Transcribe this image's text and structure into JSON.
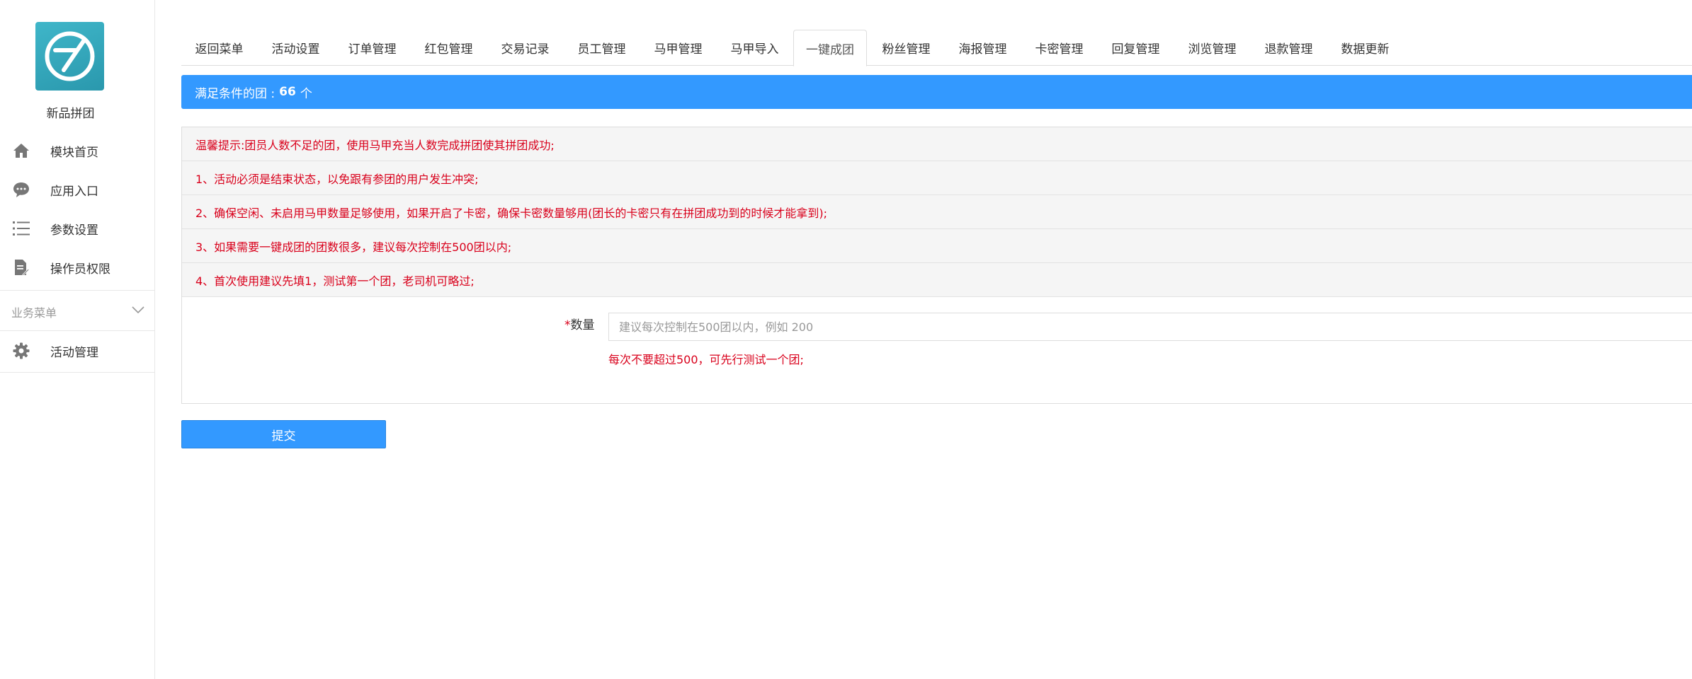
{
  "sidebar": {
    "logo_icon": "app-logo-icon",
    "brand": "新品拼团",
    "items": [
      {
        "label": "模块首页",
        "icon": "home-icon"
      },
      {
        "label": "应用入口",
        "icon": "chat-bubble-icon"
      },
      {
        "label": "参数设置",
        "icon": "list-icon"
      },
      {
        "label": "操作员权限",
        "icon": "document-edit-icon"
      }
    ],
    "section_label": "业务菜单",
    "section_items": [
      {
        "label": "活动管理",
        "icon": "gear-icon"
      }
    ]
  },
  "tabs": [
    {
      "label": "返回菜单"
    },
    {
      "label": "活动设置"
    },
    {
      "label": "订单管理"
    },
    {
      "label": "红包管理"
    },
    {
      "label": "交易记录"
    },
    {
      "label": "员工管理"
    },
    {
      "label": "马甲管理"
    },
    {
      "label": "马甲导入"
    },
    {
      "label": "一键成团",
      "active": true
    },
    {
      "label": "粉丝管理"
    },
    {
      "label": "海报管理"
    },
    {
      "label": "卡密管理"
    },
    {
      "label": "回复管理"
    },
    {
      "label": "浏览管理"
    },
    {
      "label": "退款管理"
    },
    {
      "label": "数据更新"
    }
  ],
  "info_bar": {
    "prefix": "满足条件的团 :",
    "count": "66",
    "unit": "个"
  },
  "notices": [
    "温馨提示:团员人数不足的团，使用马甲充当人数完成拼团使其拼团成功;",
    "1、活动必须是结束状态，以免跟有参团的用户发生冲突;",
    "2、确保空闲、未启用马甲数量足够使用，如果开启了卡密，确保卡密数量够用(团长的卡密只有在拼团成功到的时候才能拿到);",
    "3、如果需要一键成团的团数很多，建议每次控制在500团以内;",
    "4、首次使用建议先填1，测试第一个团，老司机可略过;"
  ],
  "form": {
    "required_mark": "*",
    "label": "数量",
    "value": "",
    "placeholder": "建议每次控制在500团以内，例如 200",
    "help": "每次不要超过500，可先行测试一个团;"
  },
  "submit_label": "提交",
  "colors": {
    "primary": "#3399ff",
    "warning_text": "#d9001b",
    "logo": "#2fa7bb"
  }
}
